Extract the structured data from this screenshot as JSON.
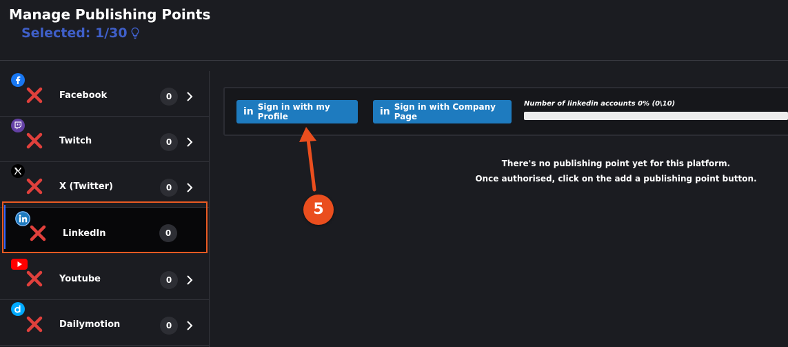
{
  "header": {
    "title": "Manage Publishing Points",
    "selected": "Selected: 1/30"
  },
  "sidebar": {
    "items": [
      {
        "label": "Facebook",
        "count": "0",
        "icon": "facebook-icon",
        "color": "#1877f2"
      },
      {
        "label": "Twitch",
        "count": "0",
        "icon": "twitch-icon",
        "color": "#6441a5"
      },
      {
        "label": "X (Twitter)",
        "count": "0",
        "icon": "x-icon",
        "color": "#000000"
      },
      {
        "label": "LinkedIn",
        "count": "0",
        "icon": "linkedin-icon",
        "color": "#1e7bbf"
      },
      {
        "label": "Youtube",
        "count": "0",
        "icon": "youtube-icon",
        "color": "#ff0000"
      },
      {
        "label": "Dailymotion",
        "count": "0",
        "icon": "dailymotion-icon",
        "color": "#00aaff"
      }
    ]
  },
  "main": {
    "sign_in_profile": "Sign in with my Profile",
    "sign_in_company": "Sign in with Company Page",
    "accounts_label": "Number of linkedin accounts 0% (0\\10)",
    "accounts_progress": 0,
    "message_line1": "There's no publishing point yet for this platform.",
    "message_line2": "Once authorised, click on the add a publishing point button."
  },
  "annotation": {
    "step": "5"
  },
  "colors": {
    "accent": "#3f5fc9",
    "button": "#1e7bbf",
    "highlight": "#ea5a22",
    "error": "#e0403c"
  }
}
